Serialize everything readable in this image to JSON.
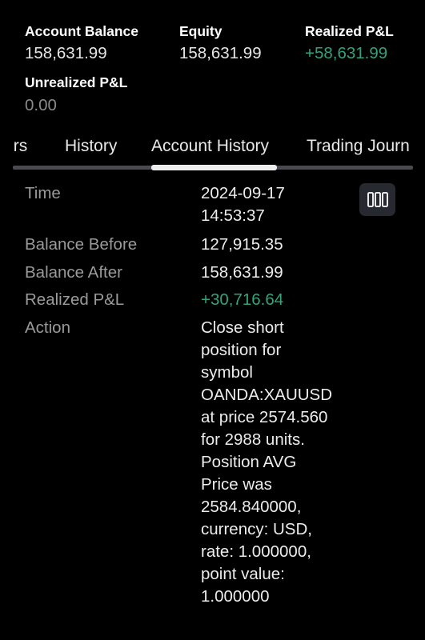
{
  "summary": {
    "account_balance": {
      "label": "Account Balance",
      "value": "158,631.99"
    },
    "equity": {
      "label": "Equity",
      "value": "158,631.99"
    },
    "realized_pnl": {
      "label": "Realized P&L",
      "value": "+58,631.99"
    },
    "unrealized_pnl": {
      "label": "Unrealized P&L",
      "value": "0.00"
    }
  },
  "tabs": [
    {
      "label": "Orders",
      "visible_text": "ers"
    },
    {
      "label": "History"
    },
    {
      "label": "Account History",
      "active": true
    },
    {
      "label": "Trading Journal",
      "visible_text": "Trading Journ"
    }
  ],
  "detail": {
    "time": {
      "label": "Time",
      "value_line1": "2024-09-17",
      "value_line2": "14:53:37"
    },
    "balance_before": {
      "label": "Balance Before",
      "value": "127,915.35"
    },
    "balance_after": {
      "label": "Balance After",
      "value": "158,631.99"
    },
    "realized_pnl": {
      "label": "Realized P&L",
      "value": "+30,716.64"
    },
    "action": {
      "label": "Action",
      "value": "Close short position for symbol OANDA:XAUUSD at price 2574.560 for 2988 units. Position AVG Price was 2584.840000, currency: USD, rate: 1.000000, point value: 1.000000"
    }
  },
  "toolbar": {
    "columns_icon": "columns-icon"
  },
  "colors": {
    "background": "#000000",
    "positive": "#34a27a",
    "muted_label": "#9a9a9a",
    "tab_track": "#4a4a52",
    "tab_indicator": "#ececec",
    "button_bg": "#26292f"
  }
}
